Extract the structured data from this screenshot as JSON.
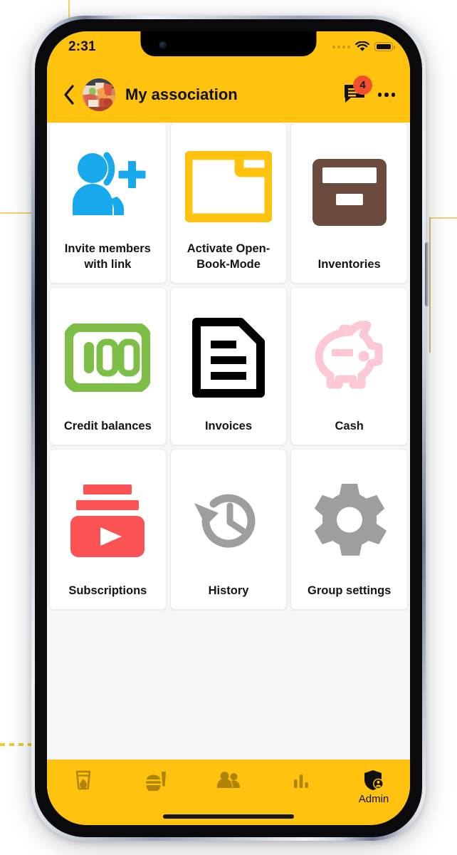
{
  "device": {
    "frame": "iphone",
    "home_indicator": true
  },
  "status_bar": {
    "time": "2:31",
    "signal_icon": "signal-dots-icon",
    "wifi_icon": "wifi-icon",
    "battery_icon": "battery-full-icon"
  },
  "app_bar": {
    "back_icon": "chevron-left-icon",
    "avatar": "group-photo-avatar",
    "title": "My association",
    "chat_icon": "chat-bubble-icon",
    "chat_badge": "4",
    "overflow_icon": "more-horizontal-icon"
  },
  "grid": {
    "tiles": [
      {
        "label": "Invite members with link",
        "icon": "person-add-icon",
        "color": "#18A9ED"
      },
      {
        "label": "Activate Open-Book-Mode",
        "icon": "open-folder-icon",
        "color": "#FFC20E"
      },
      {
        "label": "Inventories",
        "icon": "archive-box-icon",
        "color": "#6B4B3E"
      },
      {
        "label": "Credit balances",
        "icon": "banknote-100-icon",
        "color": "#7DBE47"
      },
      {
        "label": "Invoices",
        "icon": "document-lines-icon",
        "color": "#000000"
      },
      {
        "label": "Cash",
        "icon": "piggy-bank-icon",
        "color": "#FBC8D4"
      },
      {
        "label": "Subscriptions",
        "icon": "video-stack-play-icon",
        "color": "#FB5353"
      },
      {
        "label": "History",
        "icon": "clock-rewind-icon",
        "color": "#9E9E9E"
      },
      {
        "label": "Group settings",
        "icon": "gear-icon",
        "color": "#9E9E9E"
      }
    ]
  },
  "bottom_nav": {
    "items": [
      {
        "label": "",
        "icon": "drink-glass-icon",
        "active": false
      },
      {
        "label": "",
        "icon": "meal-tray-icon",
        "active": false
      },
      {
        "label": "",
        "icon": "people-icon",
        "active": false
      },
      {
        "label": "",
        "icon": "bar-chart-icon",
        "active": false
      },
      {
        "label": "Admin",
        "icon": "shield-person-icon",
        "active": true
      }
    ]
  },
  "colors": {
    "brand_yellow": "#FFC20E",
    "badge_red": "#F4502E",
    "page_background": "#F7F7F7",
    "tile_background": "#FFFFFF",
    "text_primary": "#111111",
    "nav_inactive": "#B0840A",
    "nav_active": "#101010"
  }
}
